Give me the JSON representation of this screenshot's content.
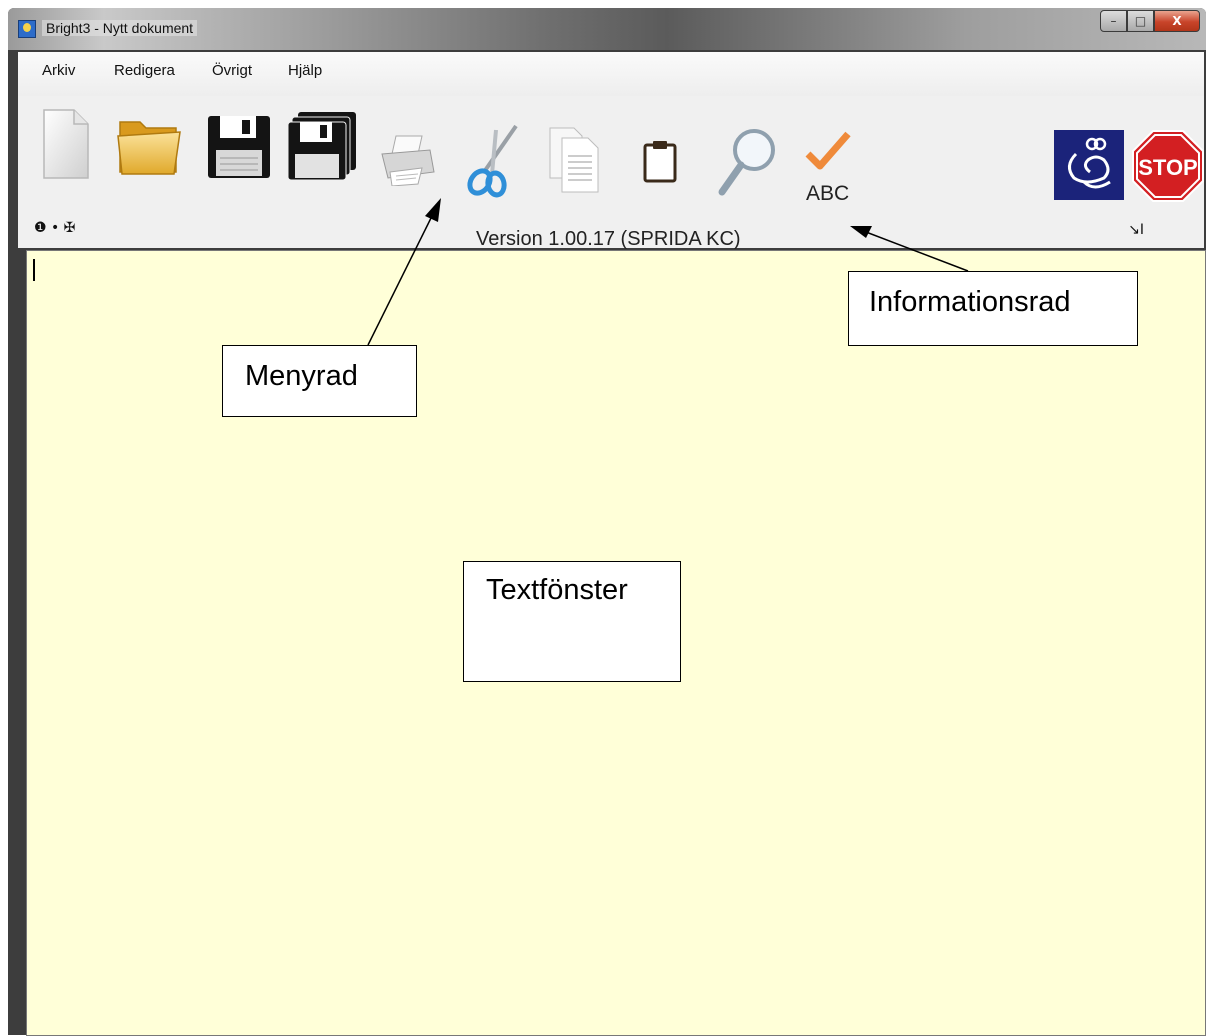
{
  "window": {
    "title": "Bright3 - Nytt dokument",
    "minimize": "–",
    "maximize": "□",
    "close": "X"
  },
  "menu": {
    "items": [
      "Arkiv",
      "Redigera",
      "Övrigt",
      "Hjälp"
    ]
  },
  "toolbar": {
    "icons": [
      "new-document-icon",
      "open-folder-icon",
      "save-floppy-icon",
      "save-all-icon",
      "print-icon",
      "cut-scissors-icon",
      "copy-icon",
      "paste-clipboard-icon",
      "search-magnifier-icon",
      "spellcheck-icon",
      "speech-icon",
      "stop-icon"
    ],
    "spellcheck_label": "ABC",
    "stop_label": "STOP"
  },
  "infobar": {
    "version": "Version 1.00.17 (SPRIDA KC)",
    "indicators": "❶ • ✠",
    "right_glyph": "↘I"
  },
  "callouts": {
    "menyrad": "Menyrad",
    "informationsrad": "Informationsrad",
    "textfonster": "Textfönster"
  }
}
